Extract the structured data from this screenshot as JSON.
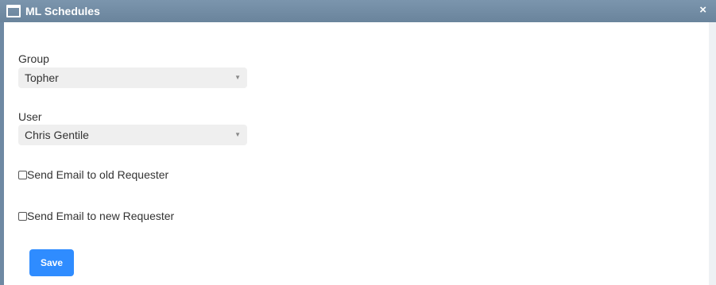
{
  "window": {
    "title": "ML Schedules",
    "close_label": "×"
  },
  "form": {
    "group_label": "Group",
    "group_value": "Topher",
    "user_label": "User",
    "user_value": "Chris Gentile",
    "send_old_label": "Send Email to old Requester",
    "send_new_label": "Send Email to new Requester",
    "send_old_checked": false,
    "send_new_checked": false,
    "save_label": "Save"
  },
  "icons": {
    "window": "window-icon",
    "close": "close-icon",
    "dropdown": "caret-down-icon"
  },
  "colors": {
    "titlebar": "#6e89a3",
    "accent": "#2f8cff",
    "select_bg": "#efefef"
  }
}
